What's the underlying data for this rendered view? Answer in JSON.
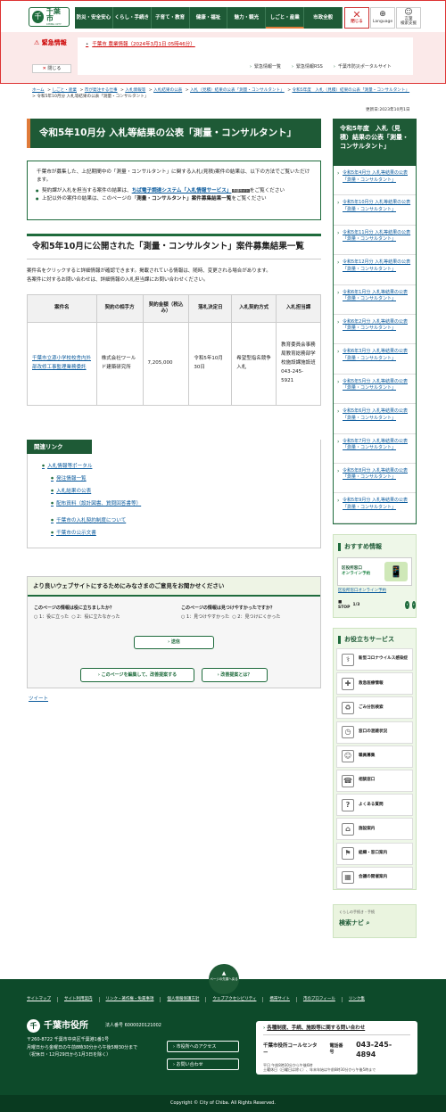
{
  "header": {
    "logo": {
      "name": "千葉市",
      "en": "CHIBA CITY",
      "mark": "千"
    },
    "nav": [
      "防災・安全安心",
      "くらし・手続き",
      "子育て・教育",
      "健康・福祉",
      "魅力・観光",
      "しごと・産業",
      "市政全般"
    ],
    "active_nav": 5,
    "close_label": "閉じる",
    "language_label": "Language",
    "talk_label1": "AI",
    "talk_label2": "言葉\n検索支援"
  },
  "emergency": {
    "title": "緊急情報",
    "close_label": "閉じる",
    "item": "千葉市 農業情報（2024年3月1日 05時46分）",
    "links": [
      "緊急情報一覧",
      "緊急情報RSS",
      "千葉市防災ポータルサイト"
    ]
  },
  "breadcrumb": [
    "ホーム",
    "しごと・産業",
    "市が発注する仕事",
    "入札情報等",
    "入札結果の公表",
    "入札（見積）結果の公表「測量・コンサルタント」",
    "令和5年度　入札（見積）結果の公表「測量・コンサルタント」",
    "令和5年10月分 入札等結果の公表「測量・コンサルタント」"
  ],
  "updated": "更新日:2023年10月1日",
  "page_title": "令和5年10月分 入札等結果の公表「測量・コンサルタント」",
  "intro": {
    "text": "千葉市が募集した、上記期間中の「測量・コンサルタント」に関する入札(見積)案件の結果は、以下の方法でご覧いただけます。",
    "item1_pre": "契約課が入札を担当する案件の結果は、",
    "item1_link": "ちば電子調達システム「入札情報サービス」",
    "item1_badge": "外部サイト",
    "item1_post": "をご覧ください",
    "item2_pre": "上記以外の案件の結果は、このページの「",
    "item2_bold": "測量・コンサルタント」案件募集結果一覧",
    "item2_post": "をご覧ください"
  },
  "section_title": "令和5年10月に公開された「測量・コンサルタント」案件募集結果一覧",
  "note1": "案件名をクリックすると詳細情報が確認できます。掲載されている情報は、随時、変更される場合があります。",
  "note2": "各案件に対するお問い合わせは、詳細情報の入札担当課にお問い合わせください。",
  "table": {
    "headers": [
      "案件名",
      "契約の相手方",
      "契約金額（税込み）",
      "落札決定日",
      "入札契約方式",
      "入札担当課"
    ],
    "row": {
      "name": "千葉市立源小学校校舎内外部改修工事監理業務委託",
      "party": "株式会社ワールド建築研究所",
      "amount": "7,205,000",
      "date": "令和5年10月30日",
      "method": "希望型指名競争入札",
      "dept": "教育委員会事務局教育総務部学校施設課施設班 043-245-5921"
    }
  },
  "related": {
    "title": "関連リンク",
    "links": [
      "入札情報等ポータル",
      "発注情報一覧",
      "入札結果の公表",
      "配布資料（設計図書、質問回答書等）",
      "千葉市の入札契約制度について",
      "千葉市の公示文書"
    ]
  },
  "survey": {
    "title": "より良いウェブサイトにするためにみなさまのご意見をお聞かせください",
    "q1": "このページの情報は役に立ちましたか？",
    "q1_o1": "1：役に立った",
    "q1_o2": "2：役に立たなかった",
    "q2": "このページの情報は見つけやすかったですか？",
    "q2_o1": "1：見つけやすかった",
    "q2_o2": "2：見つけにくかった",
    "submit": "送信",
    "edit_btn": "このページを編集して、改善提案する",
    "about_btn": "改善提案とは？"
  },
  "tweet": "ツイート",
  "side": {
    "title": "令和5年度　入札（見積）結果の公表「測量・コンサルタント」",
    "items": [
      "令和5年4月分 入札等結果の公表「測量・コンサルタント」",
      "令和5年10月分 入札等結果の公表「測量・コンサルタント」",
      "令和5年11月分 入札等結果の公表「測量・コンサルタント」",
      "令和5年12月分 入札等結果の公表「測量・コンサルタント」",
      "令和6年1月分 入札等結果の公表「測量・コンサルタント」",
      "令和6年2月分 入札等結果の公表「測量・コンサルタント」",
      "令和6年3月分 入札等結果の公表「測量・コンサルタント」",
      "令和5年5月分 入札等結果の公表「測量・コンサルタント」",
      "令和5年6月分 入札等結果の公表「測量・コンサルタント」",
      "令和5年7月分 入札等結果の公表「測量・コンサルタント」",
      "令和5年8月分 入札等結果の公表「測量・コンサルタント」",
      "令和5年9月分 入札等結果の公表「測量・コンサルタント」"
    ],
    "recommend_title": "おすすめ情報",
    "recommend_banner1": "区役所窓口",
    "recommend_banner2": "オンライン予約",
    "recommend_link": "区役所窓口オンライン予約",
    "stop_label": "STOP",
    "stop_count": "1/3",
    "services_title": "お役立ちサービス",
    "services": [
      "新型コロナウイルス感染症",
      "救急医療情報",
      "ごみ分別検索",
      "窓口の混雑状況",
      "職員募集",
      "相談窓口",
      "よくある質問",
      "施設案内",
      "組織・窓口案内",
      "会議の開催案内"
    ],
    "navi_top": "くらしの手続き・手続",
    "navi_label": "検索ナビ"
  },
  "footer": {
    "pagetop": "ページの先頭へ戻る",
    "links": [
      "サイトマップ",
      "サイト利用案内",
      "リンク・著作権・免責事項",
      "個人情報保護方針",
      "ウェブアクセシビリティ",
      "携帯サイト",
      "市のプロフィール",
      "リンク集"
    ],
    "org": "千葉市役所",
    "corp": "法人番号 6000020121002",
    "addr1": "〒260-8722 千葉市中央区千葉港1番1号",
    "addr2": "月曜日から金曜日の午前8時30分から午後5時30分まで",
    "addr3": "（祝休日・12月29日から1月3日を除く）",
    "access": "市役所へのアクセス",
    "contact": "お問い合わせ",
    "call_title": "各種制度、手続、施設等に関する問い合わせ",
    "call_center": "千葉市役所コールセンター",
    "tel_label": "電話番号",
    "tel": "043-245-4894",
    "hours1": "平日 午前8時30分から午後6時",
    "hours2": "土曜休日（日曜日は除く）、年末年始は午前8時30分から午後5時まで",
    "copyright": "Copyright © City of Chiba. All Rights Reserved."
  },
  "colors": {
    "brand": "#1e5a36",
    "accent": "#e07b39",
    "alert": "#cc0000"
  }
}
